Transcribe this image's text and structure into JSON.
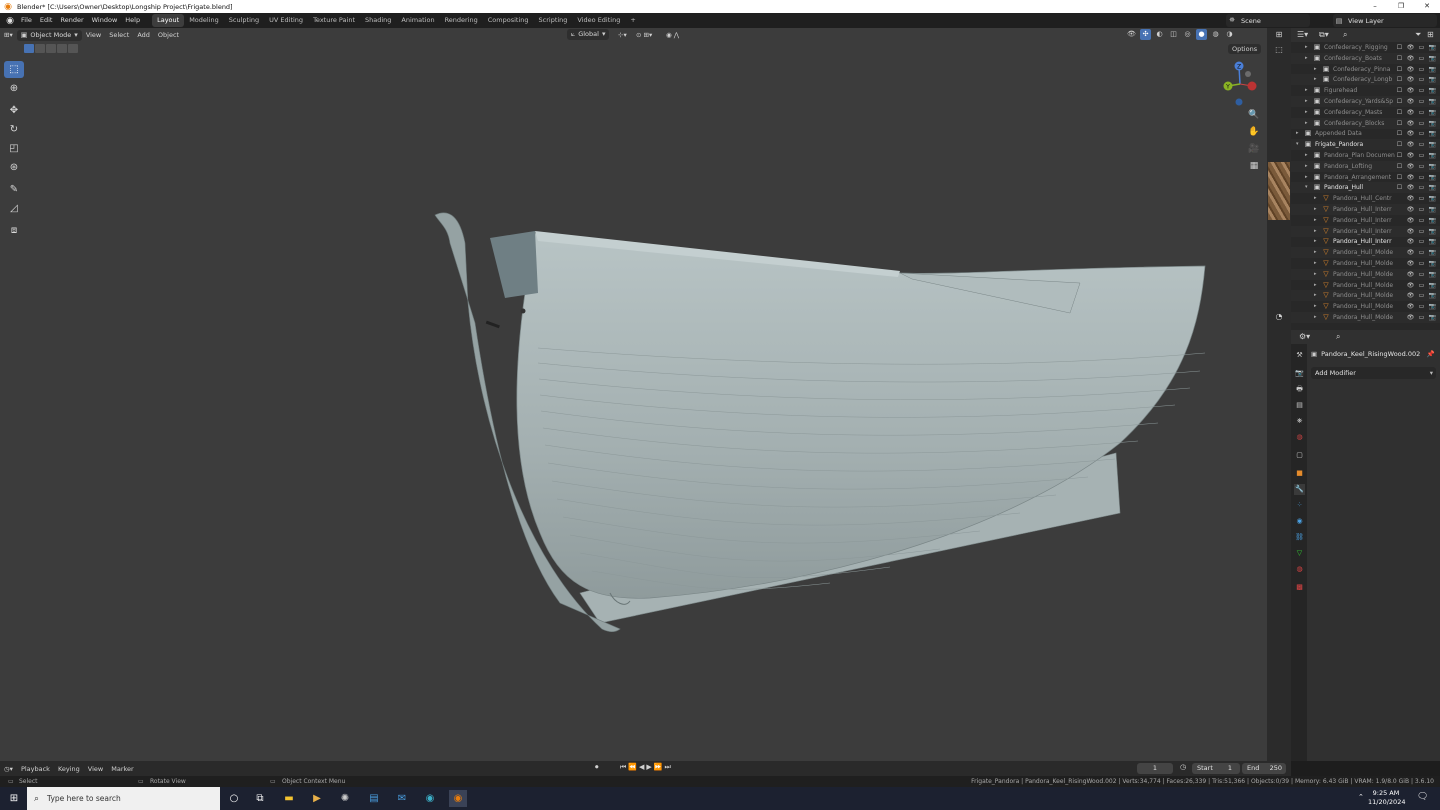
{
  "window": {
    "title": "Blender* [C:\\Users\\Owner\\Desktop\\Longship Project\\Frigate.blend]",
    "controls": [
      "–",
      "❐",
      "✕"
    ]
  },
  "menu": {
    "items": [
      "File",
      "Edit",
      "Render",
      "Window",
      "Help"
    ],
    "workspaces": [
      "Layout",
      "Modeling",
      "Sculpting",
      "UV Editing",
      "Texture Paint",
      "Shading",
      "Animation",
      "Rendering",
      "Compositing",
      "Scripting",
      "Video Editing"
    ],
    "active_workspace": "Layout",
    "add_tab": "+",
    "scene": "Scene",
    "view_layer": "View Layer"
  },
  "viewport": {
    "mode": "Object Mode",
    "menus": [
      "View",
      "Select",
      "Add",
      "Object"
    ],
    "orientation": "Global",
    "options_label": "Options",
    "gizmo": {
      "z": "Z",
      "y": "Y"
    },
    "colors": {
      "background": "#3c3c3c",
      "hull": "#a9b5b6",
      "accent": "#4772b3"
    }
  },
  "tools": [
    "select-box",
    "cursor",
    "move",
    "rotate",
    "scale",
    "transform",
    "annotate",
    "measure",
    "add-cube"
  ],
  "outliner": {
    "rows": [
      {
        "name": "Confederacy_Rigging",
        "indent": 2,
        "icon": "collection",
        "hi": false
      },
      {
        "name": "Confederacy_Boats",
        "indent": 2,
        "icon": "collection",
        "hi": false
      },
      {
        "name": "Confederacy_Pinna",
        "indent": 3,
        "icon": "collection",
        "hi": false
      },
      {
        "name": "Confederacy_Longb",
        "indent": 3,
        "icon": "collection",
        "hi": false
      },
      {
        "name": "Figurehead",
        "indent": 2,
        "icon": "collection",
        "hi": false
      },
      {
        "name": "Confederacy_Yards&Sp",
        "indent": 2,
        "icon": "collection",
        "hi": false
      },
      {
        "name": "Confederacy_Masts",
        "indent": 2,
        "icon": "collection",
        "hi": false
      },
      {
        "name": "Confederacy_Blocks",
        "indent": 2,
        "icon": "collection",
        "hi": false
      },
      {
        "name": "Appended Data",
        "indent": 1,
        "icon": "collection",
        "hi": false
      },
      {
        "name": "Frigate_Pandora",
        "indent": 1,
        "icon": "collection",
        "hi": true
      },
      {
        "name": "Pandora_Plan Documen",
        "indent": 2,
        "icon": "collection",
        "hi": false
      },
      {
        "name": "Pandora_Lofting",
        "indent": 2,
        "icon": "collection",
        "hi": false
      },
      {
        "name": "Pandora_Arrangement",
        "indent": 2,
        "icon": "collection",
        "hi": false
      },
      {
        "name": "Pandora_Hull",
        "indent": 2,
        "icon": "collection",
        "hi": true
      },
      {
        "name": "Pandora_Hull_Centr",
        "indent": 3,
        "icon": "mesh",
        "hi": false
      },
      {
        "name": "Pandora_Hull_Interr",
        "indent": 3,
        "icon": "mesh",
        "hi": false
      },
      {
        "name": "Pandora_Hull_Interr",
        "indent": 3,
        "icon": "mesh",
        "hi": false
      },
      {
        "name": "Pandora_Hull_Interr",
        "indent": 3,
        "icon": "mesh",
        "hi": false
      },
      {
        "name": "Pandora_Hull_Interr",
        "indent": 3,
        "icon": "mesh",
        "hi": true
      },
      {
        "name": "Pandora_Hull_Molde",
        "indent": 3,
        "icon": "mesh",
        "hi": false
      },
      {
        "name": "Pandora_Hull_Molde",
        "indent": 3,
        "icon": "mesh",
        "hi": false
      },
      {
        "name": "Pandora_Hull_Molde",
        "indent": 3,
        "icon": "mesh",
        "hi": false
      },
      {
        "name": "Pandora_Hull_Molde",
        "indent": 3,
        "icon": "mesh",
        "hi": false
      },
      {
        "name": "Pandora_Hull_Molde",
        "indent": 3,
        "icon": "mesh",
        "hi": false
      },
      {
        "name": "Pandora_Hull_Molde",
        "indent": 3,
        "icon": "mesh",
        "hi": false
      },
      {
        "name": "Pandora_Hull_Molde",
        "indent": 3,
        "icon": "mesh",
        "hi": false
      }
    ]
  },
  "properties": {
    "object_name": "Pandora_Keel_RisingWood.002",
    "add_modifier": "Add Modifier"
  },
  "timeline": {
    "menus": [
      "Playback",
      "Keying",
      "View",
      "Marker"
    ],
    "current_frame": "1",
    "start_label": "Start",
    "start": "1",
    "end_label": "End",
    "end": "250"
  },
  "status": {
    "select": "Select",
    "rotate": "Rotate View",
    "context": "Object Context Menu",
    "stats": "Frigate_Pandora | Pandora_Keel_RisingWood.002 | Verts:34,774 | Faces:26,339 | Tris:51,366 | Objects:0/39 | Memory: 6.43 GiB | VRAM: 1.9/8.0 GiB | 3.6.10"
  },
  "taskbar": {
    "search_placeholder": "Type here to search",
    "time": "9:25 AM",
    "date": "11/20/2024"
  }
}
